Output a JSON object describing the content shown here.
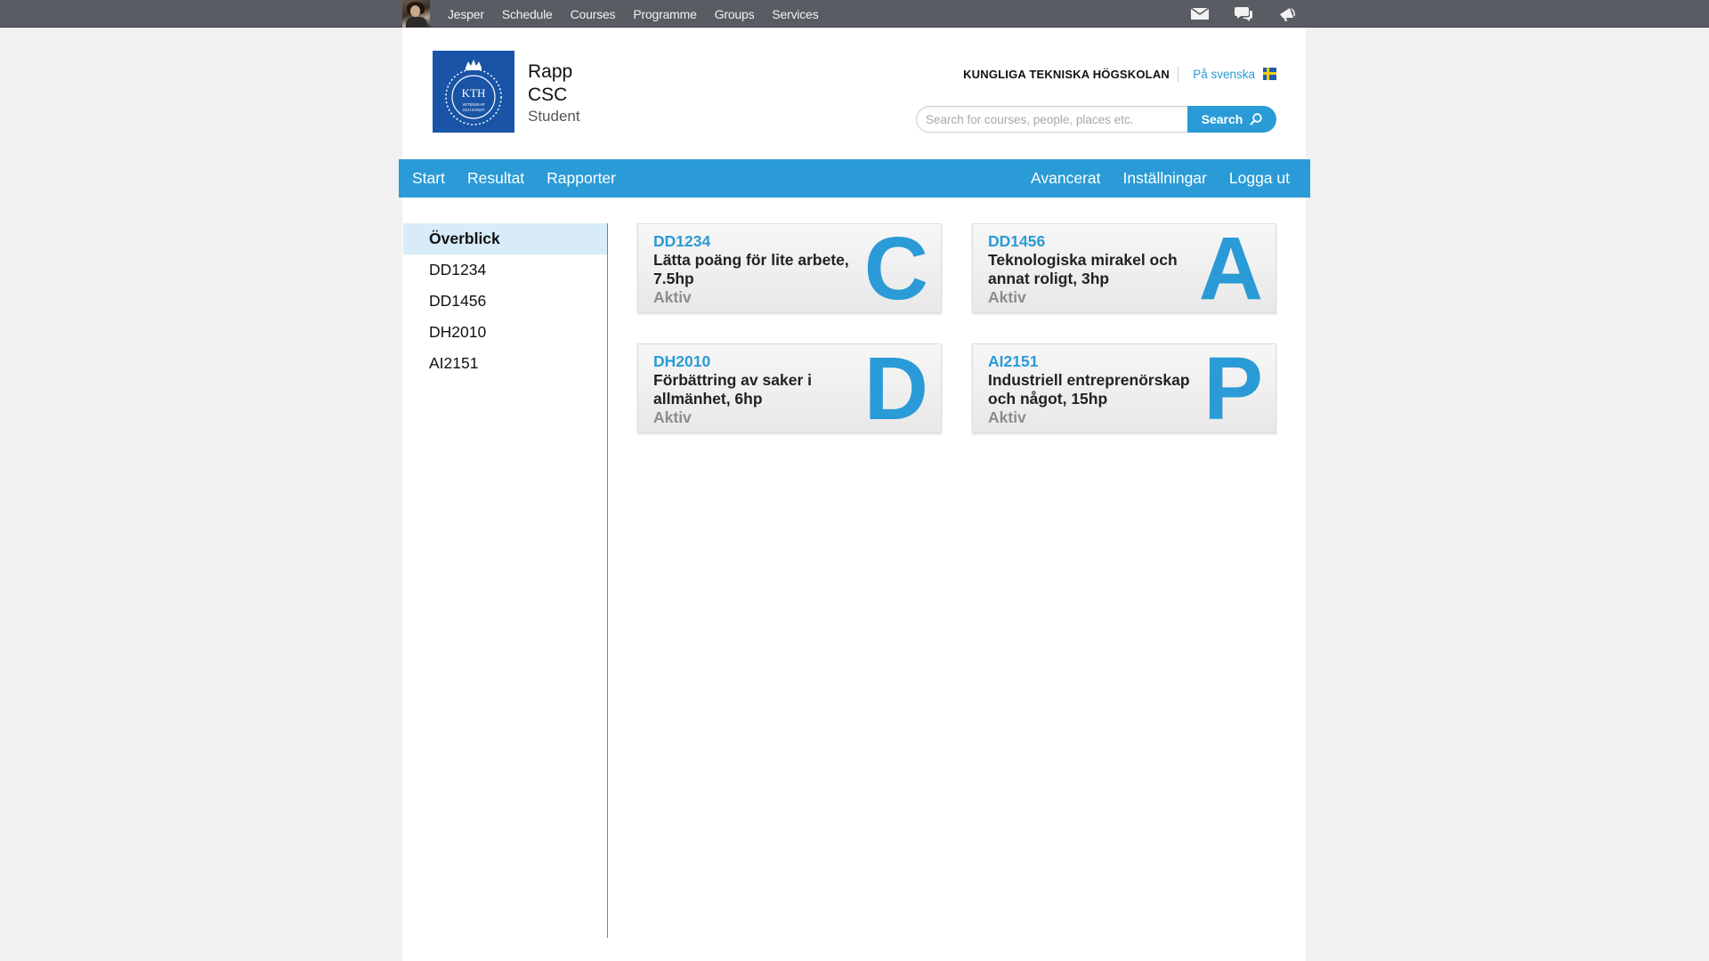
{
  "topbar": {
    "menu": [
      "Jesper",
      "Schedule",
      "Courses",
      "Programme",
      "Groups",
      "Services"
    ],
    "icons": [
      "mail-icon",
      "chat-icon",
      "megaphone-icon"
    ]
  },
  "header": {
    "logo_text": "KTH",
    "logo_subtext": "VETENSKAP OCH KONST",
    "app_line1": "Rapp",
    "app_line2": "CSC",
    "app_line3": "Student",
    "school": "KUNGLIGA TEKNISKA HÖGSKOLAN",
    "language_link": "På svenska",
    "search_placeholder": "Search for courses, people, places etc.",
    "search_button": "Search"
  },
  "nav": {
    "left": [
      "Start",
      "Resultat",
      "Rapporter"
    ],
    "right": [
      "Avancerat",
      "Inställningar",
      "Logga ut"
    ]
  },
  "sidebar": {
    "items": [
      {
        "label": "Överblick",
        "active": true
      },
      {
        "label": "DD1234",
        "active": false
      },
      {
        "label": "DD1456",
        "active": false
      },
      {
        "label": "DH2010",
        "active": false
      },
      {
        "label": "AI2151",
        "active": false
      }
    ]
  },
  "courses": [
    {
      "code": "DD1234",
      "name": "Lätta poäng för lite arbete, 7.5hp",
      "status": "Aktiv",
      "grade": "C"
    },
    {
      "code": "DD1456",
      "name": "Teknologiska mirakel och annat roligt, 3hp",
      "status": "Aktiv",
      "grade": "A"
    },
    {
      "code": "DH2010",
      "name": "Förbättring av saker i allmänhet, 6hp",
      "status": "Aktiv",
      "grade": "D"
    },
    {
      "code": "AI2151",
      "name": "Industriell entreprenörskap och något, 15hp",
      "status": "Aktiv",
      "grade": "P"
    }
  ],
  "colors": {
    "accent": "#2a9bd6",
    "topbar": "#5a5c63",
    "logo": "#1954a6"
  }
}
